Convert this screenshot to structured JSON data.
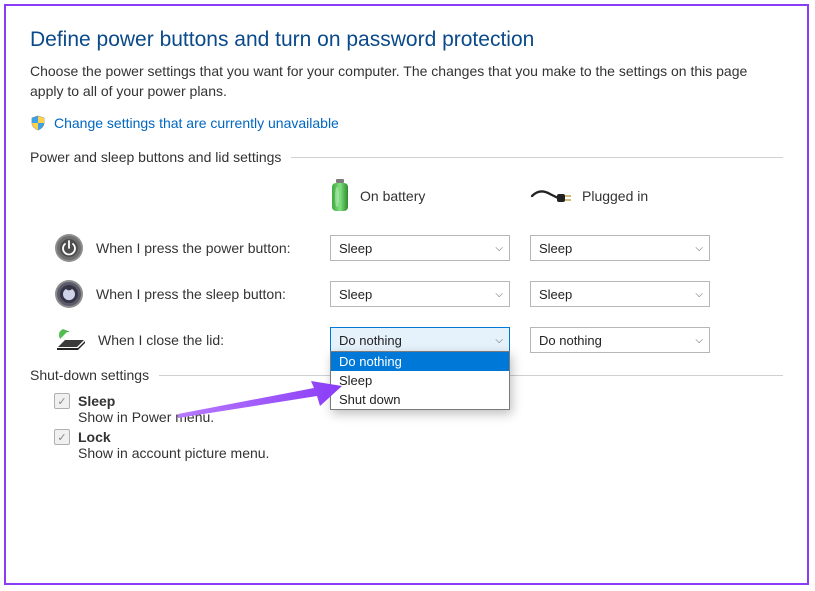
{
  "page": {
    "title": "Define power buttons and turn on password protection",
    "description": "Choose the power settings that you want for your computer. The changes that you make to the settings on this page apply to all of your power plans.",
    "change_link": "Change settings that are currently unavailable"
  },
  "sections": {
    "power_sleep": "Power and sleep buttons and lid settings",
    "shutdown": "Shut-down settings"
  },
  "columns": {
    "battery": "On battery",
    "plugged": "Plugged in"
  },
  "rows": {
    "power_button": "When I press the power button:",
    "sleep_button": "When I press the sleep button:",
    "close_lid": "When I close the lid:"
  },
  "values": {
    "power_button_battery": "Sleep",
    "power_button_plugged": "Sleep",
    "sleep_button_battery": "Sleep",
    "sleep_button_plugged": "Sleep",
    "close_lid_battery": "Do nothing",
    "close_lid_plugged": "Do nothing"
  },
  "lid_dropdown": {
    "options": [
      "Do nothing",
      "Sleep",
      "Shut down"
    ],
    "selected_index": 0
  },
  "shutdown": {
    "sleep": {
      "title": "Sleep",
      "desc": "Show in Power menu."
    },
    "lock": {
      "title": "Lock",
      "desc": "Show in account picture menu."
    }
  },
  "colors": {
    "frame_border": "#8a3cf7",
    "heading": "#0a4a8a",
    "link": "#0066c0",
    "dropdown_highlight": "#0078d7",
    "arrow": "#9b3cf7"
  }
}
